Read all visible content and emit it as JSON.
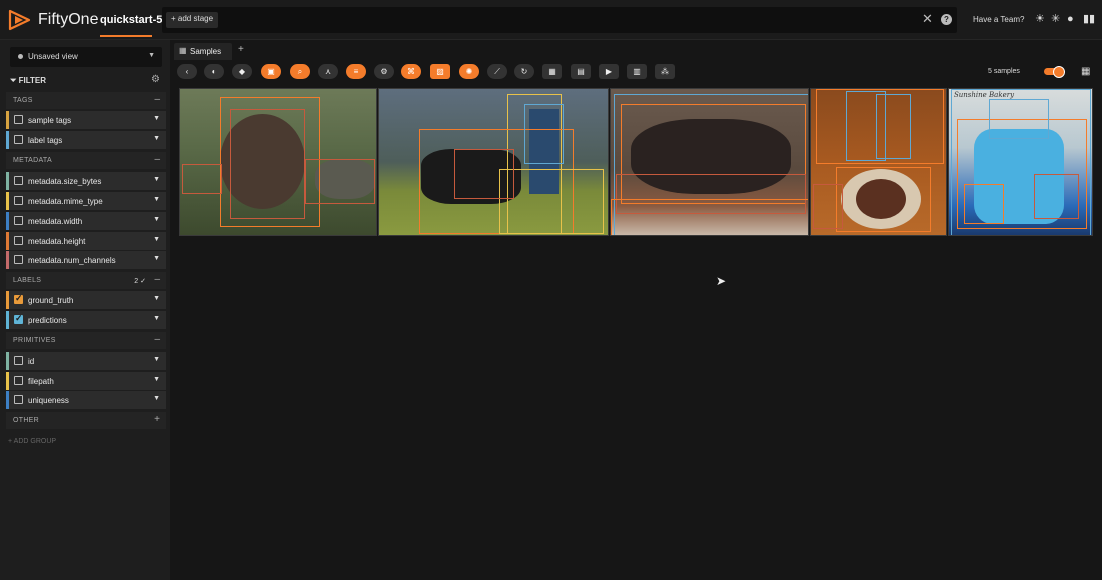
{
  "header": {
    "app_title": "FiftyOne",
    "dataset_name": "quickstart-5",
    "add_stage": "+ add stage",
    "team_link": "Have a Team?"
  },
  "sidebar": {
    "view_selector": "Unsaved view",
    "filter_heading": "FILTER",
    "sections": {
      "tags": "TAGS",
      "metadata": "METADATA",
      "labels": "LABELS",
      "labels_badge": "2 ✓",
      "primitives": "PRIMITIVES",
      "other": "OTHER"
    },
    "tags": [
      {
        "label": "sample tags",
        "color": "#d9a441",
        "checked": false
      },
      {
        "label": "label tags",
        "color": "#5fa8d3",
        "checked": false
      }
    ],
    "metadata": [
      {
        "label": "metadata.size_bytes",
        "color": "#7fb3a2",
        "checked": false
      },
      {
        "label": "metadata.mime_type",
        "color": "#e8c24a",
        "checked": false
      },
      {
        "label": "metadata.width",
        "color": "#3d7fc4",
        "checked": false
      },
      {
        "label": "metadata.height",
        "color": "#e07a35",
        "checked": false
      },
      {
        "label": "metadata.num_channels",
        "color": "#c46a6a",
        "checked": false
      }
    ],
    "labels": [
      {
        "label": "ground_truth",
        "color": "#e89a3a",
        "checked": true
      },
      {
        "label": "predictions",
        "color": "#5fb4d6",
        "checked": true
      }
    ],
    "primitives": [
      {
        "label": "id",
        "color": "#7fb3a2",
        "checked": false
      },
      {
        "label": "filepath",
        "color": "#e8c24a",
        "checked": false
      },
      {
        "label": "uniqueness",
        "color": "#3d7fc4",
        "checked": false
      }
    ],
    "add_group": "+ ADD GROUP"
  },
  "tabs": {
    "samples": "Samples"
  },
  "toolbar": {
    "sample_count": "5 samples"
  },
  "thumbnails": [
    {
      "subject": "turkey",
      "sky": "#6d7a58",
      "ground": "#3d4a2e"
    },
    {
      "subject": "rider-on-horse",
      "sky": "#5e6e7e",
      "ground": "#7a8a3a"
    },
    {
      "subject": "cat-on-rug",
      "sky": "#5a4a3e",
      "ground": "#8a5a40"
    },
    {
      "subject": "dinner-table",
      "sky": "#8a4a1e",
      "ground": "#b86a2a"
    },
    {
      "subject": "birthday-cake",
      "sky": "#cfd8dc",
      "ground": "#2a6ab8"
    }
  ],
  "thumbnail_captions": {
    "cake_text": "Sunshine Bakery"
  }
}
